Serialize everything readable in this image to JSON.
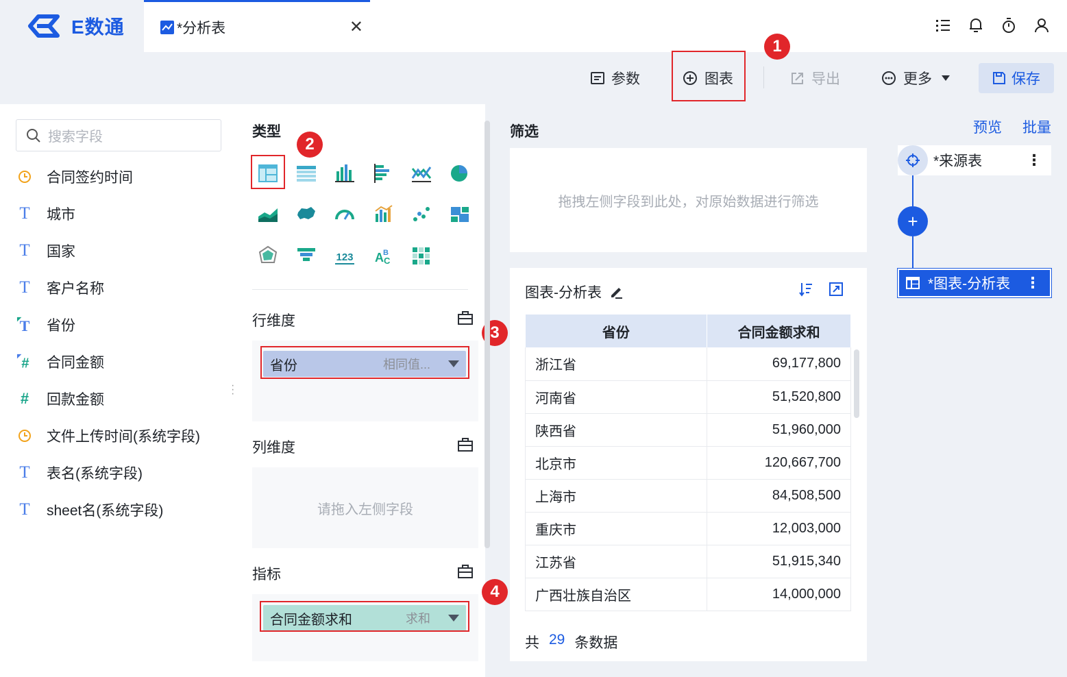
{
  "app": {
    "logo_text": "E数通"
  },
  "tab": {
    "title": "*分析表",
    "close": "✕"
  },
  "toolbar": {
    "params_label": "参数",
    "chart_label": "图表",
    "export_label": "导出",
    "more_label": "更多",
    "save_label": "保存"
  },
  "badges": [
    "1",
    "2",
    "3",
    "4"
  ],
  "fields": {
    "search_placeholder": "搜索字段",
    "items": [
      {
        "icon": "clock-icon",
        "label": "合同签约时间"
      },
      {
        "icon": "text-T-icon",
        "label": "城市"
      },
      {
        "icon": "text-T-icon",
        "label": "国家"
      },
      {
        "icon": "text-T-icon",
        "label": "客户名称"
      },
      {
        "icon": "text-T-edited-icon",
        "label": "省份"
      },
      {
        "icon": "number-hash-edited-icon",
        "label": "合同金额"
      },
      {
        "icon": "number-hash-icon",
        "label": "回款金额"
      },
      {
        "icon": "clock-icon",
        "label": "文件上传时间(系统字段)"
      },
      {
        "icon": "text-T-icon",
        "label": "表名(系统字段)"
      },
      {
        "icon": "text-T-icon",
        "label": "sheet名(系统字段)"
      }
    ]
  },
  "config": {
    "type_title": "类型",
    "row_dim_title": "行维度",
    "col_dim_title": "列维度",
    "metric_title": "指标",
    "row_pill_label": "省份",
    "row_pill_sub": "相同值...",
    "col_placeholder": "请拖入左侧字段",
    "metric_pill_label": "合同金额求和",
    "metric_pill_sub": "求和"
  },
  "filter": {
    "title": "筛选",
    "placeholder": "拖拽左侧字段到此处，对原始数据进行筛选"
  },
  "table": {
    "title": "图表-分析表",
    "headers": [
      "省份",
      "合同金额求和"
    ],
    "rows": [
      [
        "浙江省",
        "69,177,800"
      ],
      [
        "河南省",
        "51,520,800"
      ],
      [
        "陕西省",
        "51,960,000"
      ],
      [
        "北京市",
        "120,667,700"
      ],
      [
        "上海市",
        "84,508,500"
      ],
      [
        "重庆市",
        "12,003,000"
      ],
      [
        "江苏省",
        "51,915,340"
      ],
      [
        "广西壮族自治区",
        "14,000,000"
      ]
    ],
    "count_prefix": "共",
    "count_value": "29",
    "count_suffix": "条数据"
  },
  "flow": {
    "preview_label": "预览",
    "batch_label": "批量",
    "source_node": "*来源表",
    "chart_node": "*图表-分析表"
  },
  "colors": {
    "accent": "#1c5be1",
    "highlight": "#e1262a",
    "dim_pill": "#b9c7e8",
    "metric_pill": "#b2e0d8"
  }
}
